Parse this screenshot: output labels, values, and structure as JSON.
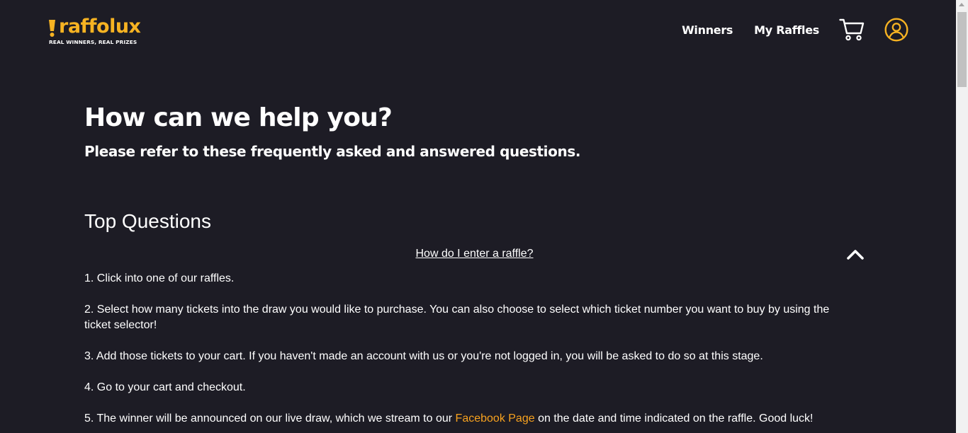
{
  "header": {
    "logo_text": "raffolux",
    "logo_tagline": "REAL WINNERS, REAL PRIZES",
    "nav": {
      "winners": "Winners",
      "my_raffles": "My Raffles"
    },
    "icons": [
      "cart-icon",
      "user-account-icon"
    ]
  },
  "hero": {
    "title": "How can we help you?",
    "subtitle": "Please refer to these frequently asked and answered questions."
  },
  "faq": {
    "section_title": "Top Questions",
    "question": "How do I enter a raffle?",
    "expanded": true,
    "steps": {
      "s1": "1. Click into one of our raffles.",
      "s2": "2. Select how many tickets into the draw you would like to purchase. You can also choose to select which ticket number you want to buy by using the ticket selector!",
      "s3": "3. Add those tickets to your cart. If you haven't made an account with us or you're not logged in, you will be asked to do so at this stage.",
      "s4": "4. Go to your cart and checkout.",
      "s5_before": "5. The winner will be announced on our live draw, which we stream to our ",
      "s5_link": "Facebook Page",
      "s5_after": " on the date and time indicated on the raffle. Good luck!"
    }
  },
  "colors": {
    "background": "#1d1c25",
    "brand": "#f7b322",
    "link": "#f7a21f",
    "text": "#ffffff"
  }
}
